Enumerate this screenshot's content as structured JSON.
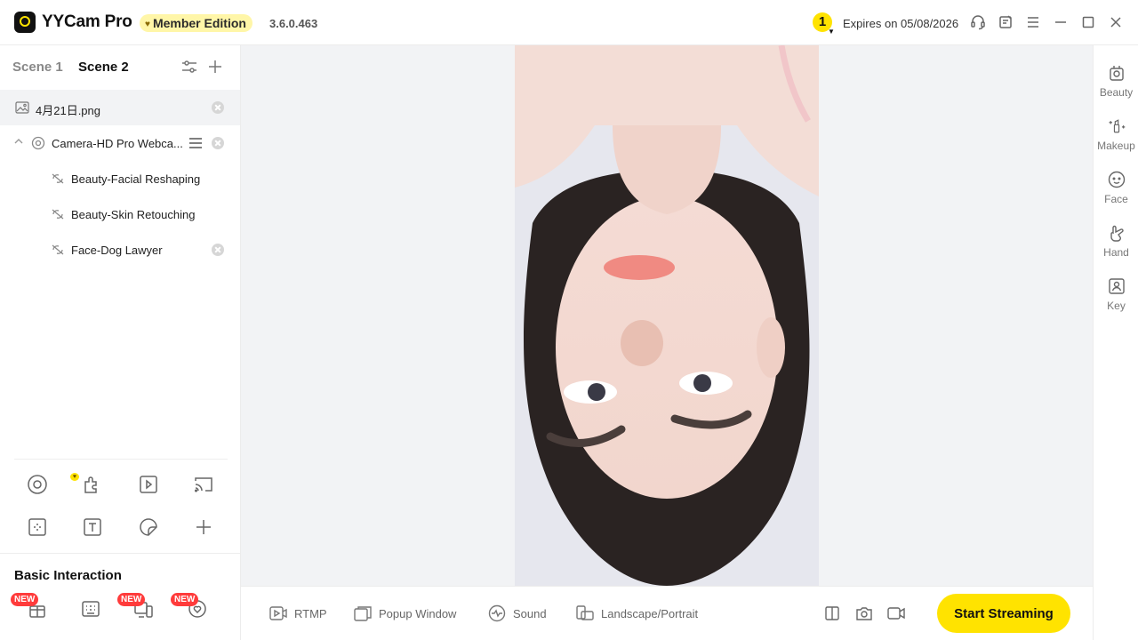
{
  "titlebar": {
    "app_name": "YYCam Pro",
    "member_label": "Member Edition",
    "version": "3.6.0.463",
    "notification_count": "1",
    "expires": "Expires on 05/08/2026",
    "icons": [
      "headset-icon",
      "feedback-icon",
      "menu-icon",
      "minimize-icon",
      "maximize-icon",
      "close-icon"
    ]
  },
  "scenes": {
    "tabs": [
      "Scene 1",
      "Scene 2"
    ],
    "active": "Scene 2"
  },
  "sources": {
    "image_name": "4月21日.png",
    "camera_name": "Camera-HD Pro Webca...",
    "effects": [
      "Beauty-Facial Reshaping",
      "Beauty-Skin Retouching",
      "Face-Dog Lawyer"
    ]
  },
  "tools": {
    "icons": [
      "camera-source-icon",
      "plugin-icon",
      "media-icon",
      "cast-icon",
      "capture-region-icon",
      "text-icon",
      "sticker-icon",
      "add-icon"
    ]
  },
  "basic_interaction": {
    "title": "Basic Interaction",
    "new_badge": "NEW",
    "icons": [
      "gift-icon",
      "keyboard-icon",
      "devices-icon",
      "heart-badge-icon"
    ]
  },
  "bottom_bar": {
    "rtmp": "RTMP",
    "popup": "Popup Window",
    "sound": "Sound",
    "orientation": "Landscape/Portrait",
    "start": "Start Streaming"
  },
  "right_rail": {
    "items": [
      "Beauty",
      "Makeup",
      "Face",
      "Hand",
      "Key"
    ]
  },
  "colors": {
    "accent": "#ffe300",
    "member_bg": "#fff6a8",
    "new_badge": "#ff3b3b"
  }
}
